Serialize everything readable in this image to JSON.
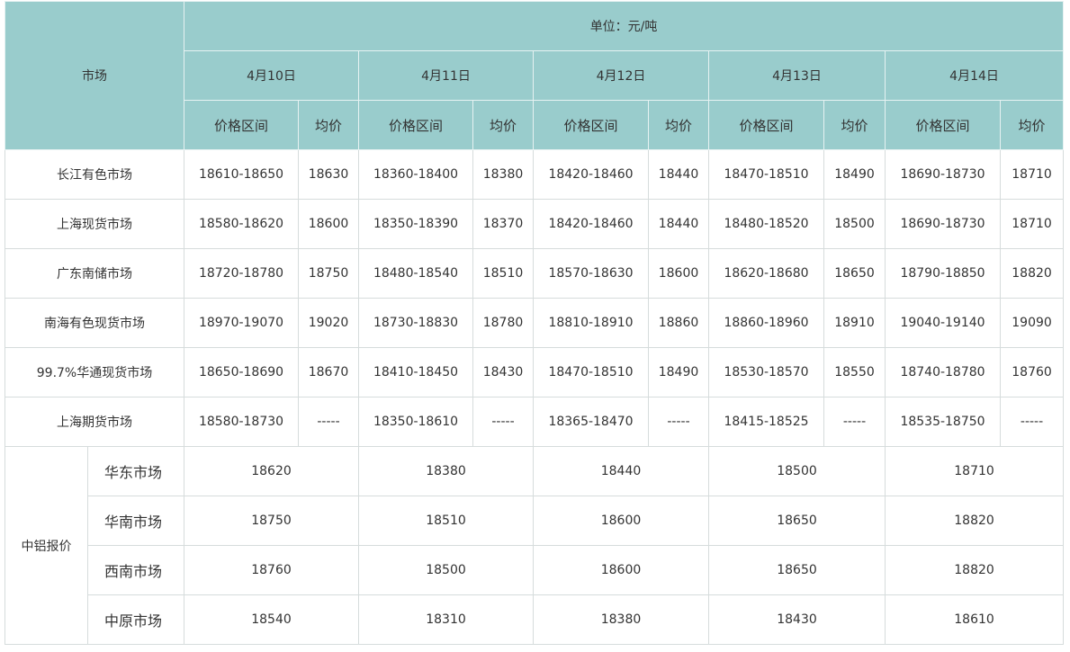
{
  "header": {
    "unit": "单位：元/吨",
    "market_label": "市场",
    "dates": [
      "4月10日",
      "4月11日",
      "4月12日",
      "4月13日",
      "4月14日"
    ],
    "range_label": "价格区间",
    "avg_label": "均价"
  },
  "markets": [
    {
      "name": "长江有色市场",
      "cells": [
        {
          "range": "18610-18650",
          "avg": "18630"
        },
        {
          "range": "18360-18400",
          "avg": "18380"
        },
        {
          "range": "18420-18460",
          "avg": "18440"
        },
        {
          "range": "18470-18510",
          "avg": "18490"
        },
        {
          "range": "18690-18730",
          "avg": "18710"
        }
      ]
    },
    {
      "name": "上海现货市场",
      "cells": [
        {
          "range": "18580-18620",
          "avg": "18600"
        },
        {
          "range": "18350-18390",
          "avg": "18370"
        },
        {
          "range": "18420-18460",
          "avg": "18440"
        },
        {
          "range": "18480-18520",
          "avg": "18500"
        },
        {
          "range": "18690-18730",
          "avg": "18710"
        }
      ]
    },
    {
      "name": "广东南储市场",
      "cells": [
        {
          "range": "18720-18780",
          "avg": "18750"
        },
        {
          "range": "18480-18540",
          "avg": "18510"
        },
        {
          "range": "18570-18630",
          "avg": "18600"
        },
        {
          "range": "18620-18680",
          "avg": "18650"
        },
        {
          "range": "18790-18850",
          "avg": "18820"
        }
      ]
    },
    {
      "name": "南海有色现货市场",
      "cells": [
        {
          "range": "18970-19070",
          "avg": "19020"
        },
        {
          "range": "18730-18830",
          "avg": "18780"
        },
        {
          "range": "18810-18910",
          "avg": "18860"
        },
        {
          "range": "18860-18960",
          "avg": "18910"
        },
        {
          "range": "19040-19140",
          "avg": "19090"
        }
      ]
    },
    {
      "name": "99.7%华通现货市场",
      "cells": [
        {
          "range": "18650-18690",
          "avg": "18670"
        },
        {
          "range": "18410-18450",
          "avg": "18430"
        },
        {
          "range": "18470-18510",
          "avg": "18490"
        },
        {
          "range": "18530-18570",
          "avg": "18550"
        },
        {
          "range": "18740-18780",
          "avg": "18760"
        }
      ]
    },
    {
      "name": "上海期货市场",
      "cells": [
        {
          "range": "18580-18730",
          "avg": "-----"
        },
        {
          "range": "18350-18610",
          "avg": "-----"
        },
        {
          "range": "18365-18470",
          "avg": "-----"
        },
        {
          "range": "18415-18525",
          "avg": "-----"
        },
        {
          "range": "18535-18750",
          "avg": "-----"
        }
      ]
    }
  ],
  "zhonglv": {
    "label": "中铝报价",
    "rows": [
      {
        "name": "华东市场",
        "values": [
          "18620",
          "18380",
          "18440",
          "18500",
          "18710"
        ]
      },
      {
        "name": "华南市场",
        "values": [
          "18750",
          "18510",
          "18600",
          "18650",
          "18820"
        ]
      },
      {
        "name": "西南市场",
        "values": [
          "18760",
          "18500",
          "18600",
          "18650",
          "18820"
        ]
      },
      {
        "name": "中原市场",
        "values": [
          "18540",
          "18310",
          "18380",
          "18430",
          "18610"
        ]
      }
    ]
  }
}
